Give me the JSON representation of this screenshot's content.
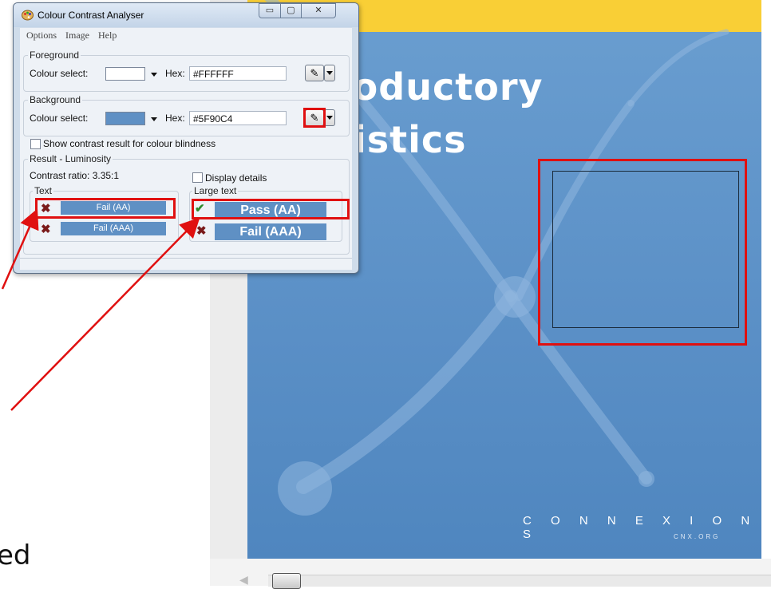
{
  "window": {
    "title": "Colour Contrast Analyser",
    "min_glyph": "▭",
    "max_glyph": "▢",
    "close_glyph": "✕"
  },
  "menu": [
    "Options",
    "Image",
    "Help"
  ],
  "foreground": {
    "group_label": "Foreground",
    "colour_select_label": "Colour select:",
    "hex_label": "Hex:",
    "hex_value": "#FFFFFF",
    "swatch_color": "#FFFFFF"
  },
  "background": {
    "group_label": "Background",
    "colour_select_label": "Colour select:",
    "hex_label": "Hex:",
    "hex_value": "#5F90C4",
    "swatch_color": "#5F90C4"
  },
  "colour_blindness_label": "Show contrast result for colour blindness",
  "result": {
    "group_label": "Result - Luminosity",
    "contrast_ratio": "Contrast ratio: 3.35:1",
    "display_details_label": "Display details",
    "text_label": "Text",
    "large_text_label": "Large text",
    "text_aa": "Fail (AA)",
    "text_aaa": "Fail (AAA)",
    "large_aa": "Pass (AA)",
    "large_aaa": "Fail (AAA)",
    "fail_glyph": "✖",
    "pass_glyph": "✔"
  },
  "cover": {
    "title_line1": "roductory",
    "title_line2": "tistics",
    "logo": "C O N N E X I O N S",
    "logo_sub": "CNX.ORG"
  },
  "left_partial_text": "ed",
  "colors": {
    "accent_red": "#E01010",
    "cover_blue": "#5F90C4",
    "cover_yellow": "#F9CF36"
  }
}
